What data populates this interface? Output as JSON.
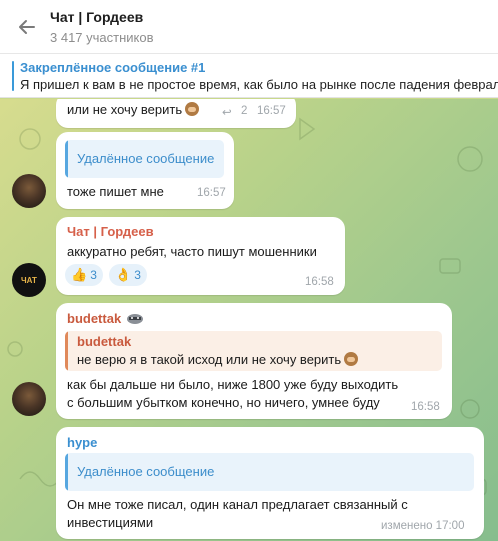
{
  "header": {
    "title": "Чат | Гордеев",
    "subtitle": "3 417 участников"
  },
  "pinned": {
    "title": "Закреплённое сообщение #1",
    "text": "Я пришел к вам в не простое время, как было на рынке после падения февраля"
  },
  "messages": [
    {
      "text": "или не хочу верить",
      "replies_count": "2",
      "time": "16:57"
    },
    {
      "reply_label": "Удалённое сообщение",
      "text": "тоже пишет мне",
      "time": "16:57"
    },
    {
      "sender": "Чат | Гордеев",
      "text": "аккуратно ребят, часто пишут мошенники",
      "reactions": [
        {
          "emoji": "👍",
          "count": "3"
        },
        {
          "emoji": "👌",
          "count": "3"
        }
      ],
      "time": "16:58",
      "avatar_text": "ЧАТ"
    },
    {
      "sender": "budettak",
      "reply_sender": "budettak",
      "reply_text": "не верю я в такой исход или не хочу верить",
      "text_line1": "как бы дальше ни было, ниже 1800 уже буду выходить",
      "text_line2": "с большим убытком конечно, но ничего, умнее буду",
      "time": "16:58"
    },
    {
      "sender": "hype",
      "reply_label": "Удалённое сообщение",
      "text_line1": "Он мне тоже писал, один канал предлагает связанный с",
      "text_line2": "инвестициями",
      "time": "изменено 17:00"
    }
  ],
  "colors": {
    "accent": "#3a8fd0",
    "sender_group": "#d6604a",
    "sender_budettak": "#c95a3e",
    "sender_hype": "#3a8fd0",
    "reaction_bg": "#e6f1fa"
  }
}
